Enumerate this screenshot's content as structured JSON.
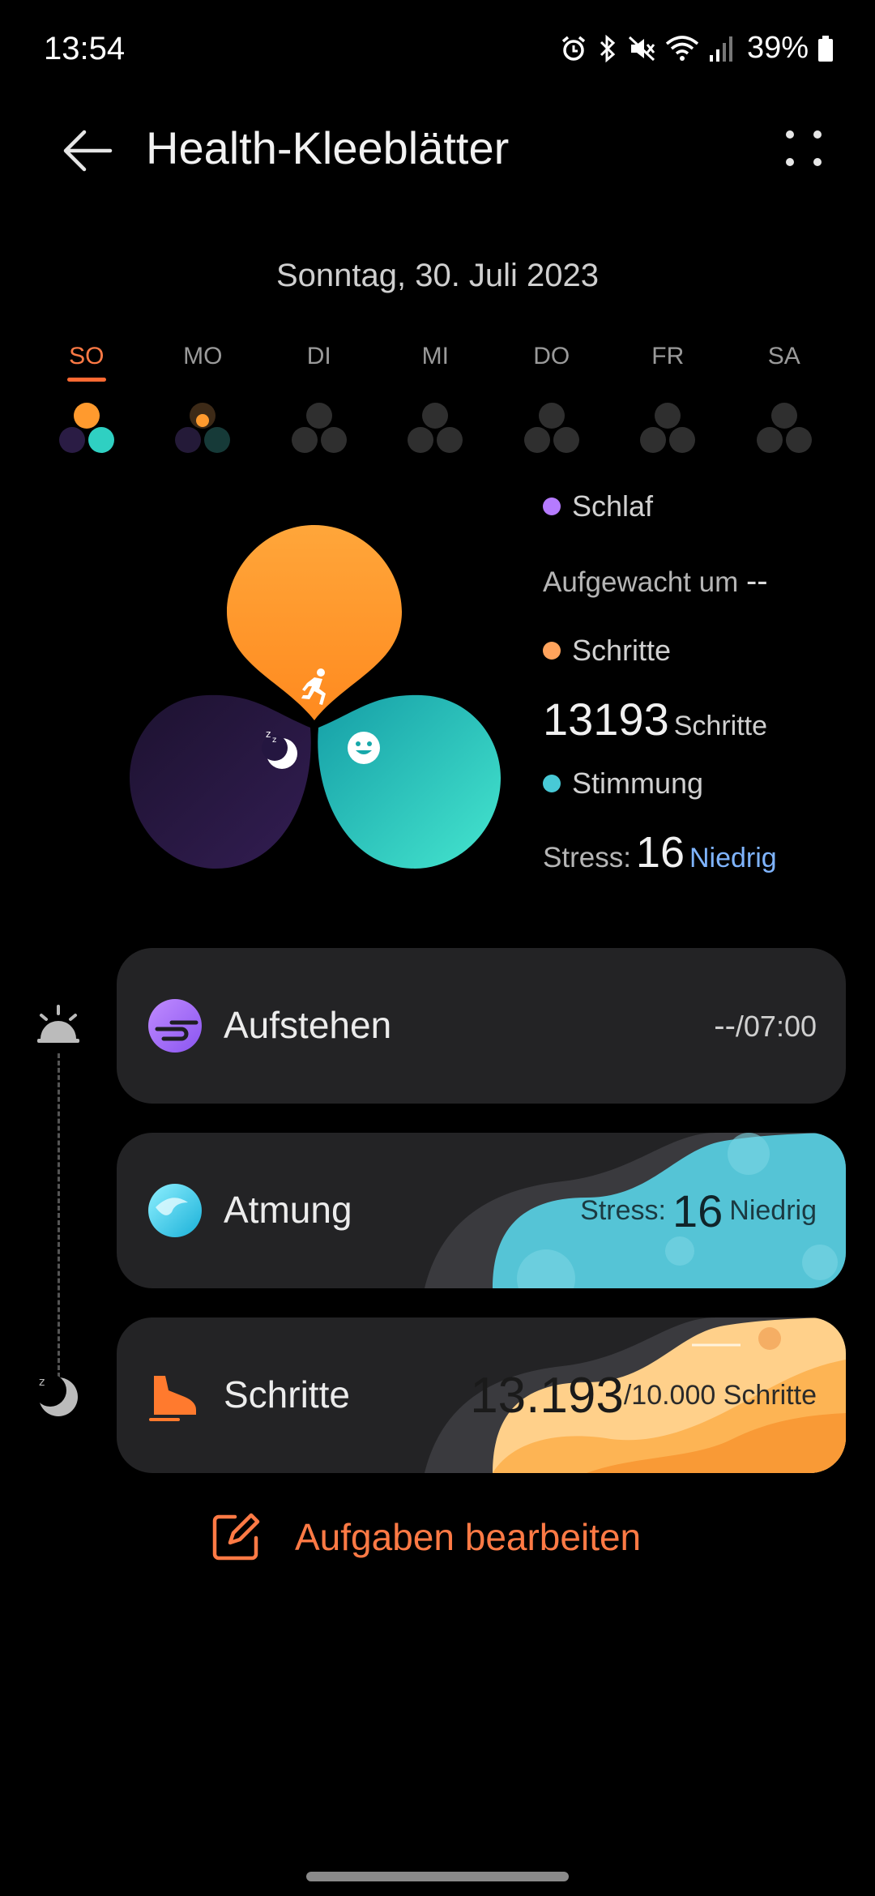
{
  "status_bar": {
    "time": "13:54",
    "battery": "39%",
    "icons": [
      "alarm-icon",
      "bluetooth-icon",
      "mute-icon",
      "wifi-icon",
      "signal-icon",
      "battery-icon"
    ]
  },
  "header": {
    "title": "Health-Kleeblätter",
    "back_icon": "arrow-left-icon",
    "more_icon": "more-dots-icon"
  },
  "date": "Sonntag, 30. Juli 2023",
  "week": [
    {
      "label": "SO",
      "active": true
    },
    {
      "label": "MO",
      "active": false
    },
    {
      "label": "DI",
      "active": false
    },
    {
      "label": "MI",
      "active": false
    },
    {
      "label": "DO",
      "active": false
    },
    {
      "label": "FR",
      "active": false
    },
    {
      "label": "SA",
      "active": false
    }
  ],
  "legend": {
    "sleep": {
      "label": "Schlaf",
      "sub_prefix": "Aufgewacht um",
      "sub_value": "--",
      "color": "#b57bff"
    },
    "steps": {
      "label": "Schritte",
      "value": "13193",
      "unit": "Schritte",
      "color": "#ffa35c"
    },
    "mood": {
      "label": "Stimmung",
      "stress_label": "Stress:",
      "stress_value": "16",
      "stress_level": "Niedrig",
      "color": "#48c9d6"
    }
  },
  "cards": {
    "aufstehen": {
      "title": "Aufstehen",
      "value_dash": "--",
      "value_target": "/07:00"
    },
    "atmung": {
      "title": "Atmung",
      "stress_label": "Stress:",
      "stress_value": "16",
      "stress_level": "Niedrig"
    },
    "schritte": {
      "title": "Schritte",
      "count": "13.193",
      "goal": "/10.000 Schritte"
    }
  },
  "edit_tasks": "Aufgaben bearbeiten",
  "colors": {
    "accent": "#ff7a45",
    "steps_orange": "#ff9a2e",
    "mood_teal": "#2ec9c0",
    "sleep_purple": "#2a1a40"
  }
}
